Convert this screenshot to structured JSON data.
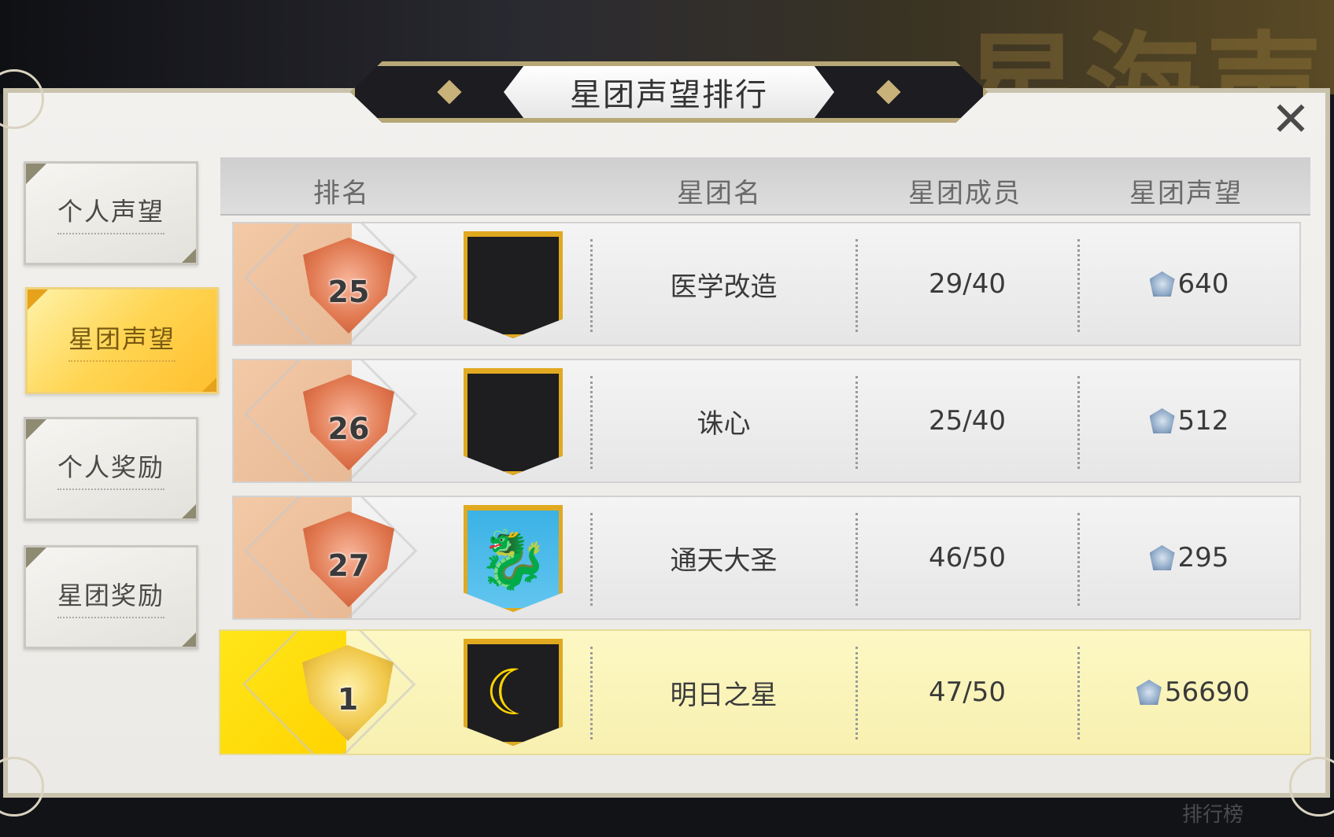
{
  "title": "星团声望排行",
  "background_text": "星海声",
  "bottom_label": "排行榜",
  "close_icon": "✕",
  "tabs": [
    {
      "label": "个人声望"
    },
    {
      "label": "星团声望"
    },
    {
      "label": "个人奖励"
    },
    {
      "label": "星团奖励"
    }
  ],
  "table": {
    "headers": {
      "rank": "排名",
      "name": "星团名",
      "members": "星团成员",
      "reputation": "星团声望"
    },
    "rows": [
      {
        "rank": "25",
        "name": "医学改造",
        "members": "29/40",
        "reputation": "640",
        "banner": "black-banner-icon"
      },
      {
        "rank": "26",
        "name": "诛心",
        "members": "25/40",
        "reputation": "512",
        "banner": "black-banner-icon"
      },
      {
        "rank": "27",
        "name": "通天大圣",
        "members": "46/50",
        "reputation": "295",
        "banner": "dragon-banner-icon"
      }
    ],
    "mine": {
      "rank": "1",
      "name": "明日之星",
      "members": "47/50",
      "reputation": "56690",
      "banner": "moon-banner-icon"
    }
  },
  "colors": {
    "active_tab": "#ffd552",
    "highlight_row": "#fdf8c4",
    "rank_badge": "#e07850",
    "banner_border": "#e0a920"
  }
}
